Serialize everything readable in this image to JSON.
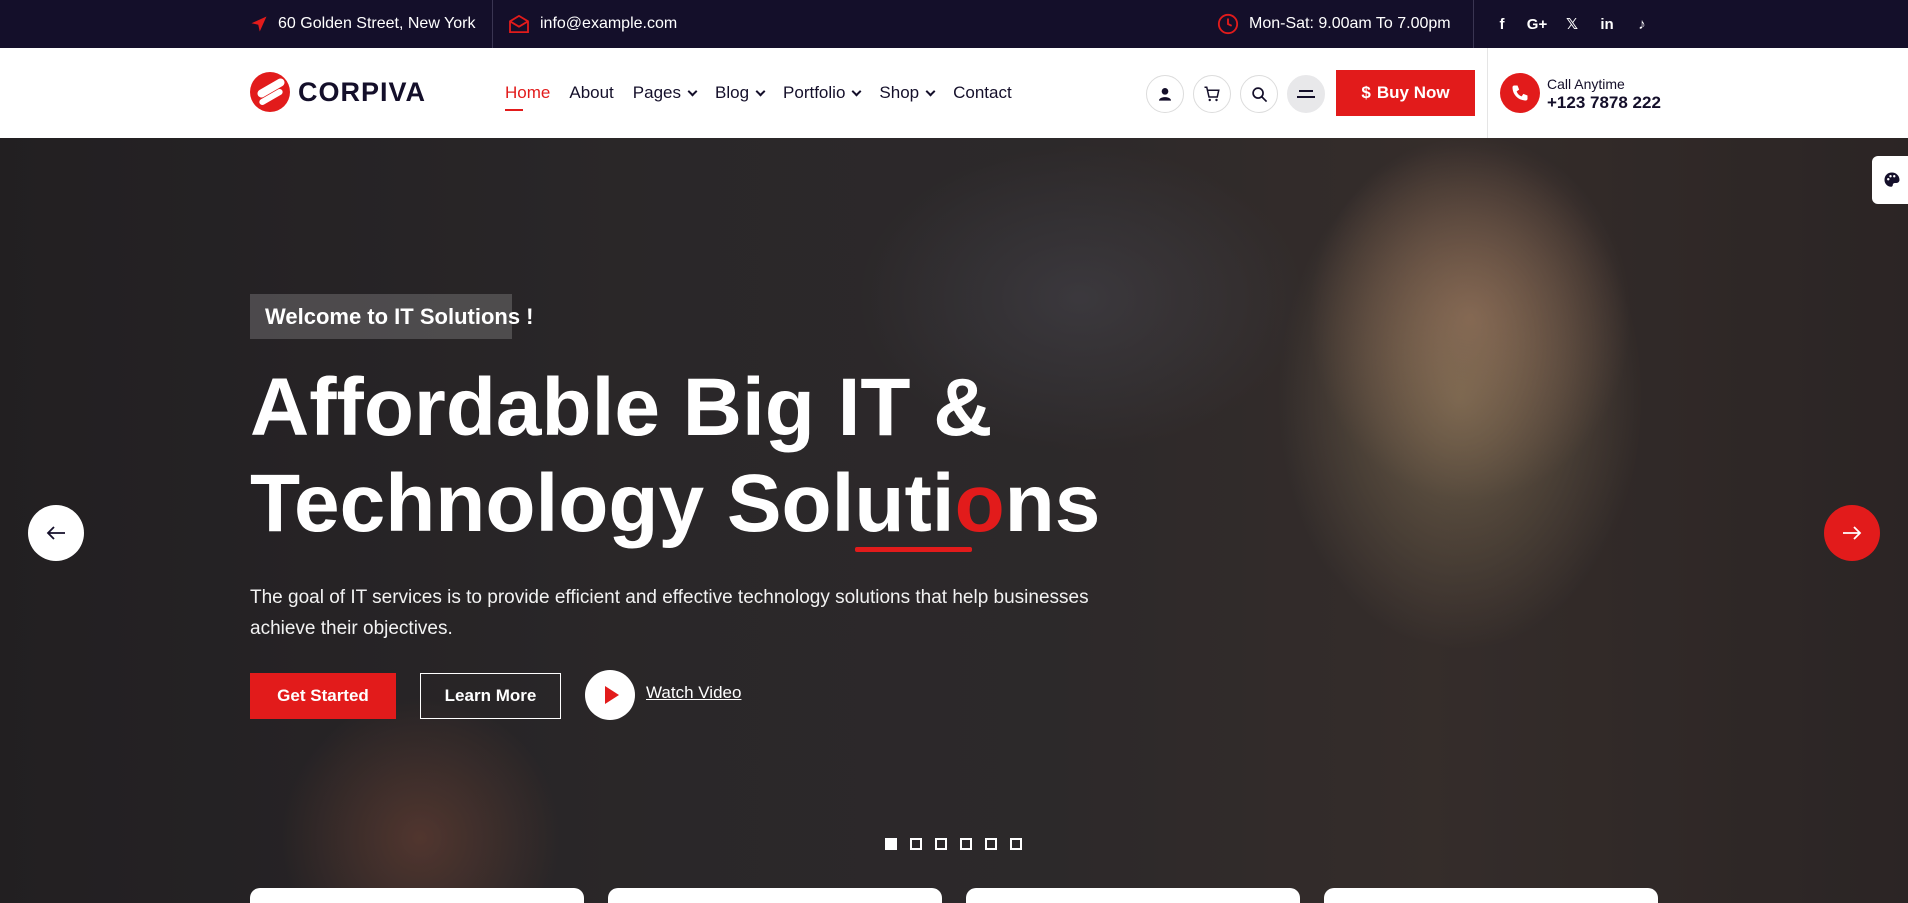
{
  "topbar": {
    "address": "60 Golden Street, New York",
    "email": "info@example.com",
    "hours": "Mon-Sat: 9.00am To 7.00pm",
    "social": [
      {
        "name": "facebook-icon",
        "glyph": "f"
      },
      {
        "name": "google-plus-icon",
        "glyph": "G+"
      },
      {
        "name": "x-twitter-icon",
        "glyph": "𝕏"
      },
      {
        "name": "linkedin-icon",
        "glyph": "in"
      },
      {
        "name": "tiktok-icon",
        "glyph": "♪"
      }
    ]
  },
  "header": {
    "logo_text": "CORPIVA",
    "nav": [
      {
        "label": "Home",
        "active": true,
        "dropdown": false
      },
      {
        "label": "About",
        "active": false,
        "dropdown": false
      },
      {
        "label": "Pages",
        "active": false,
        "dropdown": true
      },
      {
        "label": "Blog",
        "active": false,
        "dropdown": true
      },
      {
        "label": "Portfolio",
        "active": false,
        "dropdown": true
      },
      {
        "label": "Shop",
        "active": false,
        "dropdown": true
      },
      {
        "label": "Contact",
        "active": false,
        "dropdown": false
      }
    ],
    "buy_label": "Buy Now",
    "buy_icon": "$",
    "call_label": "Call Anytime",
    "call_phone": "+123 7878 222"
  },
  "hero": {
    "welcome": "Welcome to IT Solutions !",
    "title_line1": "Affordable Big IT &",
    "title_line2_a": "Technology Soluti",
    "title_line2_hl": "o",
    "title_line2_b": "ns",
    "description": "The goal of IT services is to provide efficient and effective technology solutions that help businesses achieve their objectives.",
    "primary_cta": "Get Started",
    "secondary_cta": "Learn More",
    "video_link": "Watch Video",
    "slide_count": 6,
    "active_slide": 1
  },
  "colors": {
    "accent": "#e21b1b",
    "dark": "#140f2a"
  }
}
